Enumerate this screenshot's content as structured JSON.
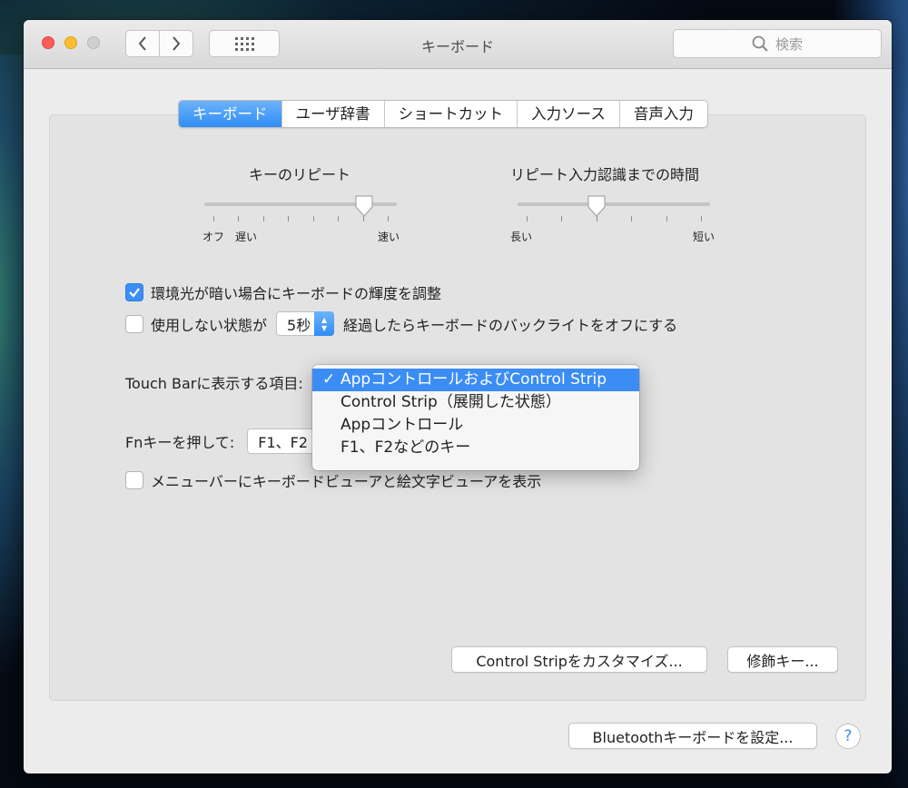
{
  "window": {
    "title": "キーボード",
    "search_placeholder": "検索"
  },
  "tabs": [
    {
      "label": "キーボード",
      "active": true
    },
    {
      "label": "ユーザ辞書",
      "active": false
    },
    {
      "label": "ショートカット",
      "active": false
    },
    {
      "label": "入力ソース",
      "active": false
    },
    {
      "label": "音声入力",
      "active": false
    }
  ],
  "key_repeat": {
    "title": "キーのリピート",
    "label_off": "オフ",
    "label_slow": "遅い",
    "label_fast": "速い",
    "value_fraction": 0.83
  },
  "repeat_delay": {
    "title": "リピート入力認識までの時間",
    "label_long": "長い",
    "label_short": "短い",
    "value_fraction": 0.41
  },
  "ambient": {
    "label": "環境光が暗い場合にキーボードの輝度を調整",
    "checked": true
  },
  "backlight_off": {
    "label_before": "使用しない状態が",
    "value": "5秒",
    "label_after": "経過したらキーボードのバックライトをオフにする",
    "checked": false
  },
  "touchbar": {
    "label": "Touch Barに表示する項目:"
  },
  "fn": {
    "label": "Fnキーを押して:",
    "value": "F1、F2"
  },
  "menu": {
    "items": [
      {
        "label": "AppコントロールおよびControl Strip",
        "selected": true
      },
      {
        "label": "Control Strip（展開した状態）",
        "selected": false
      },
      {
        "label": "Appコントロール",
        "selected": false
      },
      {
        "label": "F1、F2などのキー",
        "selected": false
      }
    ],
    "check_mark": "✓"
  },
  "viewer": {
    "label": "メニューバーにキーボードビューアと絵文字ビューアを表示",
    "checked": false
  },
  "buttons": {
    "customize": "Control Stripをカスタマイズ...",
    "modifier": "修飾キー...",
    "bluetooth": "Bluetoothキーボードを設定...",
    "help": "?"
  },
  "colors": {
    "accent": "#3b8df5",
    "close": "#fc5f57",
    "minimize": "#fdbc2e"
  }
}
